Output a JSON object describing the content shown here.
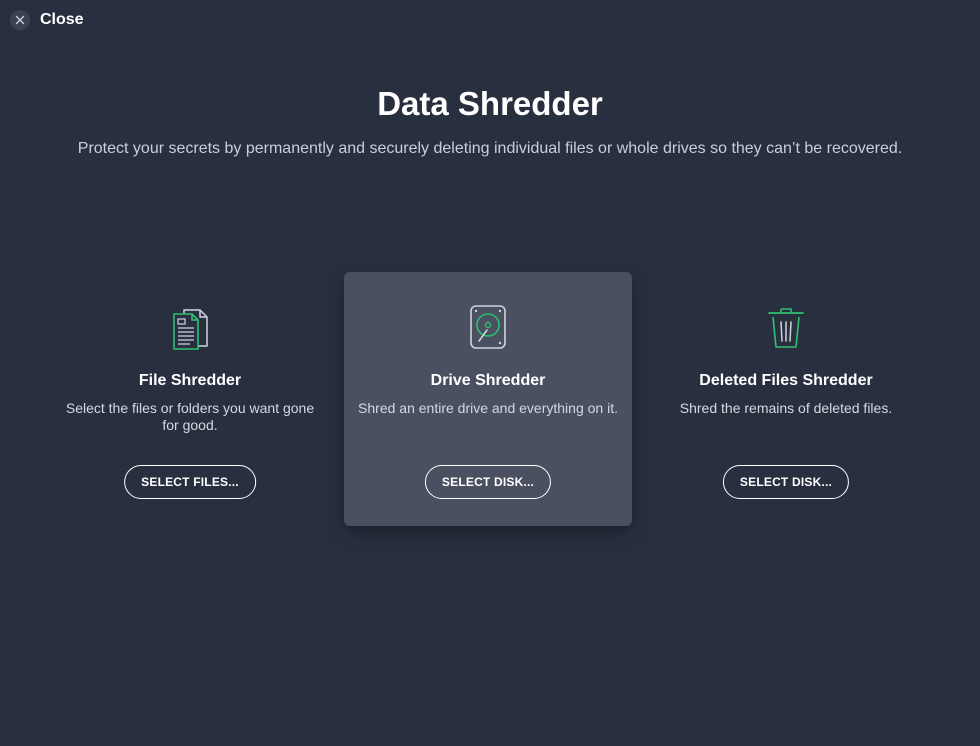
{
  "close": {
    "label": "Close",
    "icon": "close-icon"
  },
  "header": {
    "title": "Data Shredder",
    "subtitle": "Protect your secrets by permanently and securely deleting individual files or whole drives so they can’t be recovered."
  },
  "colors": {
    "background": "#283040",
    "highlight_card": "#4a5060",
    "icon_accent": "#2fbf71",
    "text_muted": "#c9ced8"
  },
  "cards": [
    {
      "icon": "document-icon",
      "title": "File Shredder",
      "description": "Select the files or folders you want gone for good.",
      "button": "SELECT FILES..."
    },
    {
      "icon": "hard-drive-icon",
      "title": "Drive Shredder",
      "description": "Shred an entire drive and everything on it.",
      "button": "SELECT DISK..."
    },
    {
      "icon": "trash-can-icon",
      "title": "Deleted Files Shredder",
      "description": "Shred the remains of deleted files.",
      "button": "SELECT DISK..."
    }
  ]
}
